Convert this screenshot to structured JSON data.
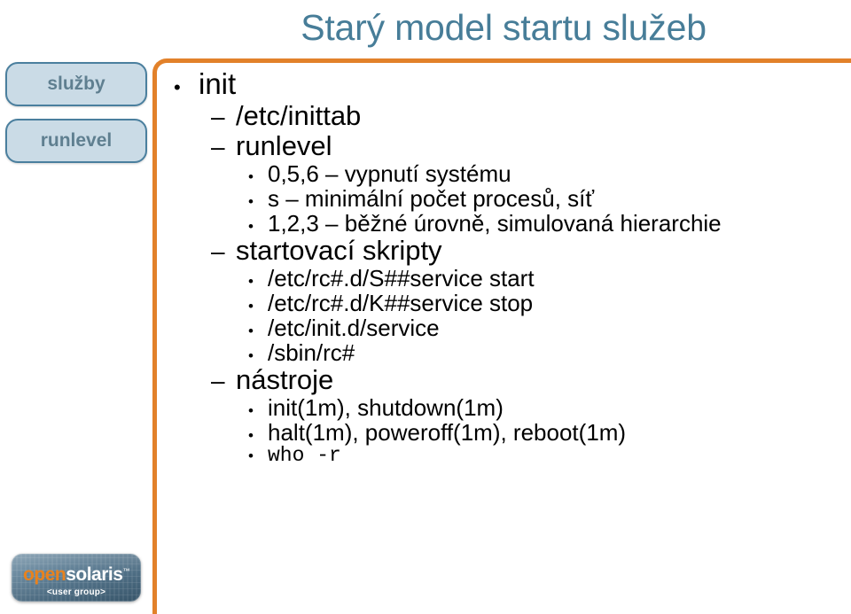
{
  "slide": {
    "title": "Starý model startu služeb"
  },
  "sidebar": {
    "items": [
      {
        "label": "služby"
      },
      {
        "label": "runlevel"
      }
    ]
  },
  "content": {
    "bullets": [
      {
        "level": 1,
        "marker": "•",
        "text": "init"
      },
      {
        "level": 2,
        "marker": "–",
        "text": "/etc/inittab"
      },
      {
        "level": 2,
        "marker": "–",
        "text": "runlevel"
      },
      {
        "level": 3,
        "marker": "•",
        "text": "0,5,6 – vypnutí systému"
      },
      {
        "level": 3,
        "marker": "•",
        "text": "s – minimální počet procesů, síť"
      },
      {
        "level": 3,
        "marker": "•",
        "text": "1,2,3 – běžné úrovně, simulovaná hierarchie"
      },
      {
        "level": 2,
        "marker": "–",
        "text": "startovací skripty"
      },
      {
        "level": 3,
        "marker": "•",
        "text": "/etc/rc#.d/S##service start"
      },
      {
        "level": 3,
        "marker": "•",
        "text": "/etc/rc#.d/K##service stop"
      },
      {
        "level": 3,
        "marker": "•",
        "text": "/etc/init.d/service"
      },
      {
        "level": 3,
        "marker": "•",
        "text": "/sbin/rc#"
      },
      {
        "level": 2,
        "marker": "–",
        "text": "nástroje"
      },
      {
        "level": 3,
        "marker": "•",
        "text": "init(1m), shutdown(1m)"
      },
      {
        "level": 3,
        "marker": "•",
        "text": "halt(1m), poweroff(1m), reboot(1m)"
      },
      {
        "level": 3,
        "marker": "•",
        "text": "who -r",
        "mono": true
      }
    ]
  },
  "logo": {
    "open": "open",
    "solaris": "solaris",
    "tm": "™",
    "usergroup": "<user group>"
  },
  "colors": {
    "accent_orange": "#e2812a",
    "title_blue": "#477d98",
    "badge_fill": "#cadbe6",
    "badge_border": "#4a7f9e",
    "badge_text": "#5f7f90",
    "logo_orange": "#e8821e"
  }
}
